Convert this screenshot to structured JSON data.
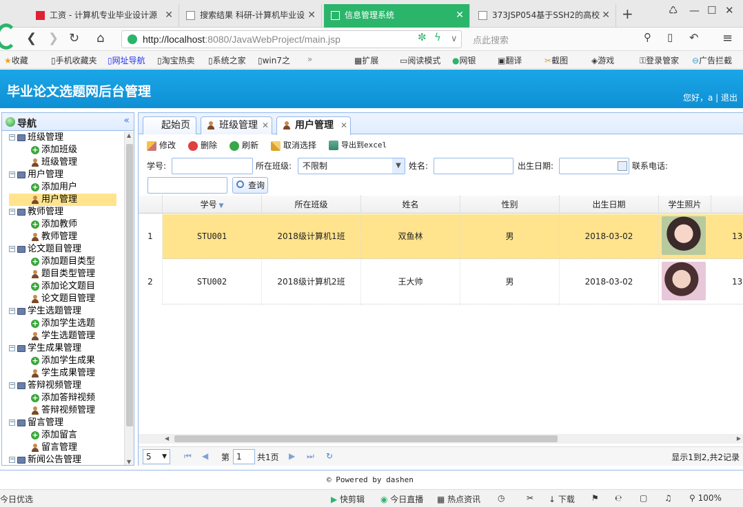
{
  "browser": {
    "tabs": [
      {
        "label": "工资 - 计算机专业毕业设计源",
        "active": false
      },
      {
        "label": "搜索结果 科研-计算机毕业设",
        "active": false
      },
      {
        "label": "信息管理系统",
        "active": true
      },
      {
        "label": "373JSP054基于SSH2的高校",
        "active": false
      }
    ],
    "url_host": "http://localhost",
    "url_rest": ":8080/JavaWebProject/main.jsp",
    "search_placeholder": "点此搜索",
    "bookmarks": [
      "收藏",
      "手机收藏夹",
      "网址导航",
      "淘宝热卖",
      "系统之家",
      "win7之",
      "扩展",
      "阅读模式",
      "网银",
      "翻译",
      "截图",
      "游戏",
      "登录管家",
      "广告拦截"
    ]
  },
  "header": {
    "title": "毕业论文选题网后台管理",
    "greeting": "您好，a  |  退出"
  },
  "nav": {
    "title": "导航",
    "collapse_icon": "«",
    "items": [
      {
        "label": "班级管理",
        "type": "group"
      },
      {
        "label": "添加班级",
        "type": "add"
      },
      {
        "label": "班级管理",
        "type": "user"
      },
      {
        "label": "用户管理",
        "type": "group"
      },
      {
        "label": "添加用户",
        "type": "add"
      },
      {
        "label": "用户管理",
        "type": "user",
        "selected": true
      },
      {
        "label": "教师管理",
        "type": "group"
      },
      {
        "label": "添加教师",
        "type": "add"
      },
      {
        "label": "教师管理",
        "type": "user"
      },
      {
        "label": "论文题目管理",
        "type": "group"
      },
      {
        "label": "添加题目类型",
        "type": "add"
      },
      {
        "label": "题目类型管理",
        "type": "user"
      },
      {
        "label": "添加论文题目",
        "type": "add"
      },
      {
        "label": "论文题目管理",
        "type": "user"
      },
      {
        "label": "学生选题管理",
        "type": "group"
      },
      {
        "label": "添加学生选题",
        "type": "add"
      },
      {
        "label": "学生选题管理",
        "type": "user"
      },
      {
        "label": "学生成果管理",
        "type": "group"
      },
      {
        "label": "添加学生成果",
        "type": "add"
      },
      {
        "label": "学生成果管理",
        "type": "user"
      },
      {
        "label": "答辩视频管理",
        "type": "group"
      },
      {
        "label": "添加答辩视频",
        "type": "add"
      },
      {
        "label": "答辩视频管理",
        "type": "user"
      },
      {
        "label": "留言管理",
        "type": "group"
      },
      {
        "label": "添加留言",
        "type": "add"
      },
      {
        "label": "留言管理",
        "type": "user"
      },
      {
        "label": "新闻公告管理",
        "type": "group"
      }
    ]
  },
  "page_tabs": [
    {
      "label": "起始页",
      "closable": false,
      "active": false
    },
    {
      "label": "班级管理",
      "closable": true,
      "active": false
    },
    {
      "label": "用户管理",
      "closable": true,
      "active": true
    }
  ],
  "toolbar": {
    "edit": "修改",
    "delete": "删除",
    "refresh": "刷新",
    "deselect": "取消选择",
    "export": "导出到excel"
  },
  "search": {
    "student_no_label": "学号:",
    "class_label": "所在班级:",
    "class_value": "不限制",
    "name_label": "姓名:",
    "birth_label": "出生日期:",
    "phone_label": "联系电话:",
    "query_button": "查询"
  },
  "grid": {
    "columns": [
      "学号",
      "所在班级",
      "姓名",
      "性别",
      "出生日期",
      "学生照片"
    ],
    "rows": [
      {
        "num": "1",
        "student_no": "STU001",
        "class": "2018级计算机1班",
        "name": "双鱼林",
        "gender": "男",
        "birth": "2018-03-02",
        "extra": "13"
      },
      {
        "num": "2",
        "student_no": "STU002",
        "class": "2018级计算机2班",
        "name": "王大帅",
        "gender": "男",
        "birth": "2018-03-02",
        "extra": "13"
      }
    ]
  },
  "pager": {
    "page_size": "5",
    "page_prefix": "第",
    "page_value": "1",
    "page_suffix": "共1页",
    "summary": "显示1到2,共2记录"
  },
  "footer": {
    "powered": "© Powered by dashen"
  },
  "statusbar": {
    "left": "今日优选",
    "items": [
      "快剪辑",
      "今日直播",
      "热点资讯",
      "下载",
      "100%"
    ]
  },
  "colors": {
    "header_bg": "#1aa6e8",
    "active_browser_tab": "#2bb56b",
    "selection": "#ffe48d",
    "border": "#95b8e7"
  }
}
